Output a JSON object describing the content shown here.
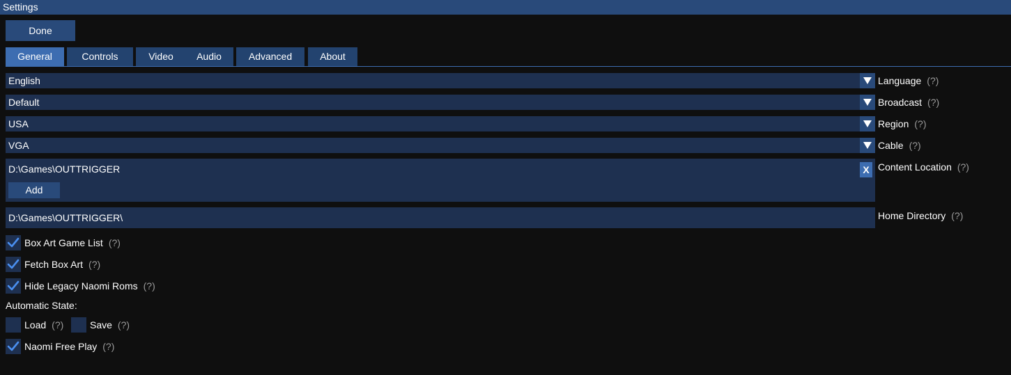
{
  "window": {
    "title": "Settings"
  },
  "done_label": "Done",
  "tabs": [
    {
      "label": "General",
      "active": true
    },
    {
      "label": "Controls",
      "active": false
    },
    {
      "label": "Video",
      "active": false
    },
    {
      "label": "Audio",
      "active": false
    },
    {
      "label": "Advanced",
      "active": false
    },
    {
      "label": "About",
      "active": false
    }
  ],
  "help_glyph": "(?)",
  "settings": {
    "language": {
      "value": "English",
      "label": "Language"
    },
    "broadcast": {
      "value": "Default",
      "label": "Broadcast"
    },
    "region": {
      "value": "USA",
      "label": "Region"
    },
    "cable": {
      "value": "VGA",
      "label": "Cable"
    },
    "content_location": {
      "label": "Content Location",
      "paths": [
        "D:\\Games\\OUTTRIGGER"
      ],
      "remove_label": "X",
      "add_label": "Add"
    },
    "home_directory": {
      "label": "Home Directory",
      "value": "D:\\Games\\OUTTRIGGER\\"
    }
  },
  "checkboxes": {
    "box_art_game_list": {
      "label": "Box Art Game List",
      "checked": true
    },
    "fetch_box_art": {
      "label": "Fetch Box Art",
      "checked": true
    },
    "hide_legacy_naomi_roms": {
      "label": "Hide Legacy Naomi Roms",
      "checked": true
    }
  },
  "automatic_state": {
    "heading": "Automatic State:",
    "load": {
      "label": "Load",
      "checked": false
    },
    "save": {
      "label": "Save",
      "checked": false
    }
  },
  "naomi_free_play": {
    "label": "Naomi Free Play",
    "checked": true
  },
  "colors": {
    "accent": "#3d6db1",
    "titlebar": "#294a7a",
    "field": "#1e3050",
    "background": "#0f0f0f",
    "check": "#4a8ff0"
  }
}
